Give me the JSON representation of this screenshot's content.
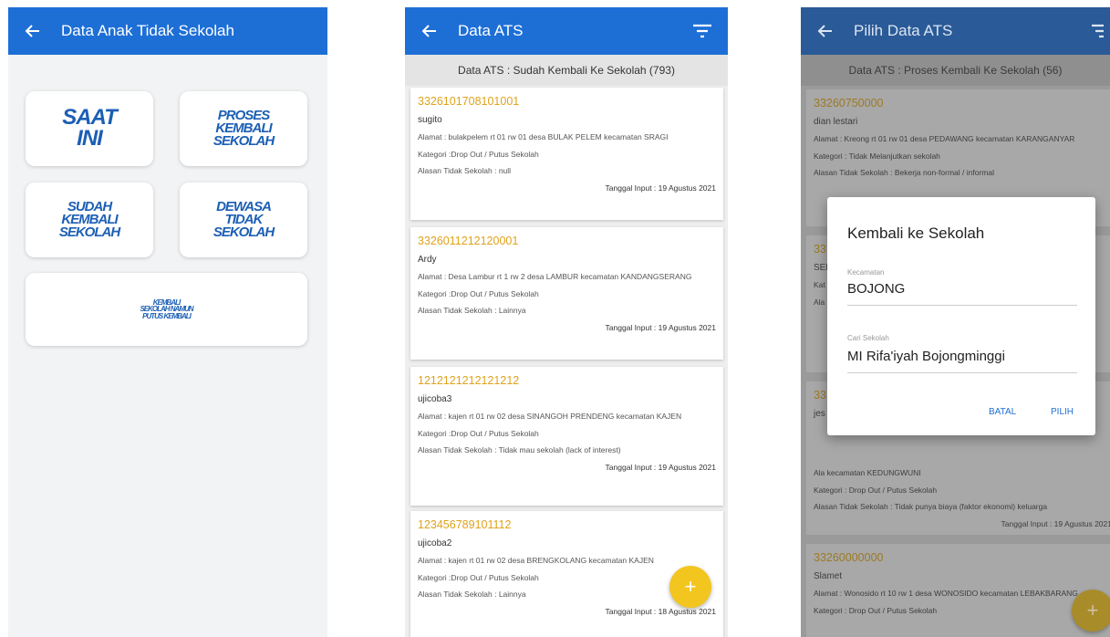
{
  "screen1": {
    "title": "Data Anak Tidak Sekolah",
    "menu": [
      "SAAT INI",
      "PROSES KEMBALI SEKOLAH",
      "SUDAH KEMBALI SEKOLAH",
      "DEWASA TIDAK SEKOLAH",
      "KEMBALI SEKOLAH NAMUN PUTUS KEMBALI"
    ]
  },
  "screen2": {
    "title": "Data ATS",
    "subheader": "Data ATS : Sudah Kembali Ke Sekolah (793)",
    "records": [
      {
        "id": "3326101708101001",
        "name": "sugito",
        "alamat": "Alamat : bulakpelem rt 01 rw 01 desa BULAK PELEM kecamatan SRAGI",
        "kategori": "Kategori :Drop Out / Putus Sekolah",
        "alasan": "Alasan Tidak Sekolah : null",
        "tanggal": "Tanggal Input : 19 Agustus 2021"
      },
      {
        "id": "3326011212120001",
        "name": "Ardy",
        "alamat": "Alamat : Desa Lambur rt 1 rw 2 desa LAMBUR kecamatan KANDANGSERANG",
        "kategori": "Kategori :Drop Out / Putus Sekolah",
        "alasan": "Alasan Tidak Sekolah : Lainnya",
        "tanggal": "Tanggal Input : 19 Agustus 2021"
      },
      {
        "id": "1212121212121212",
        "name": "ujicoba3",
        "alamat": "Alamat : kajen rt 01 rw 02 desa SINANGOH PRENDENG kecamatan KAJEN",
        "kategori": "Kategori :Drop Out / Putus Sekolah",
        "alasan": "Alasan Tidak Sekolah : Tidak mau sekolah (lack of interest)",
        "tanggal": "Tanggal Input : 19 Agustus 2021"
      },
      {
        "id": "123456789101112",
        "name": "ujicoba2",
        "alamat": "Alamat : kajen rt 01 rw 02 desa BRENGKOLANG kecamatan KAJEN",
        "kategori": "Kategori :Drop Out / Putus Sekolah",
        "alasan": "Alasan Tidak Sekolah : Lainnya",
        "tanggal": "Tanggal Input : 18 Agustus 2021"
      }
    ],
    "fab": "+"
  },
  "screen3": {
    "title": "Pilih Data ATS",
    "subheader": "Data ATS : Proses Kembali Ke Sekolah (56)",
    "records": [
      {
        "id": "33260750000",
        "name": "dian lestari",
        "alamat": "Alamat : Kreong rt 01 rw 01 desa PEDAWANG kecamatan KARANGANYAR",
        "kategori": "Kategori : Tidak Melanjutkan sekolah",
        "alasan": "Alasan Tidak Sekolah : Bekerja non-formal / informal",
        "tanggal": ""
      },
      {
        "id": "33",
        "name": "SEL",
        "alamat": "",
        "kategori": "Kat",
        "alasan": "Ala",
        "tanggal": ""
      },
      {
        "id": "33",
        "name": "jes",
        "alamat": "Ala kecamatan KEDUNGWUNI",
        "kategori": "Kategori : Drop Out / Putus Sekolah",
        "alasan": "Alasan Tidak Sekolah : Tidak punya biaya (faktor ekonomi) keluarga",
        "tanggal": "Tanggal Input : 19 Agustus 2021"
      },
      {
        "id": "33260000000",
        "name": "Slamet",
        "alamat": "Alamat : Wonosido rt 10 rw 1 desa WONOSIDO kecamatan LEBAKBARANG",
        "kategori": "Kategori : Drop Out / Putus Sekolah",
        "alasan": "",
        "tanggal": ""
      }
    ],
    "fab": "+",
    "dialog": {
      "title": "Kembali ke Sekolah",
      "kecamatan_label": "Kecamatan",
      "kecamatan_value": "BOJONG",
      "sekolah_label": "Cari Sekolah",
      "sekolah_value": "MI Rifa'iyah Bojongminggi",
      "cancel": "BATAL",
      "ok": "PILIH"
    }
  }
}
